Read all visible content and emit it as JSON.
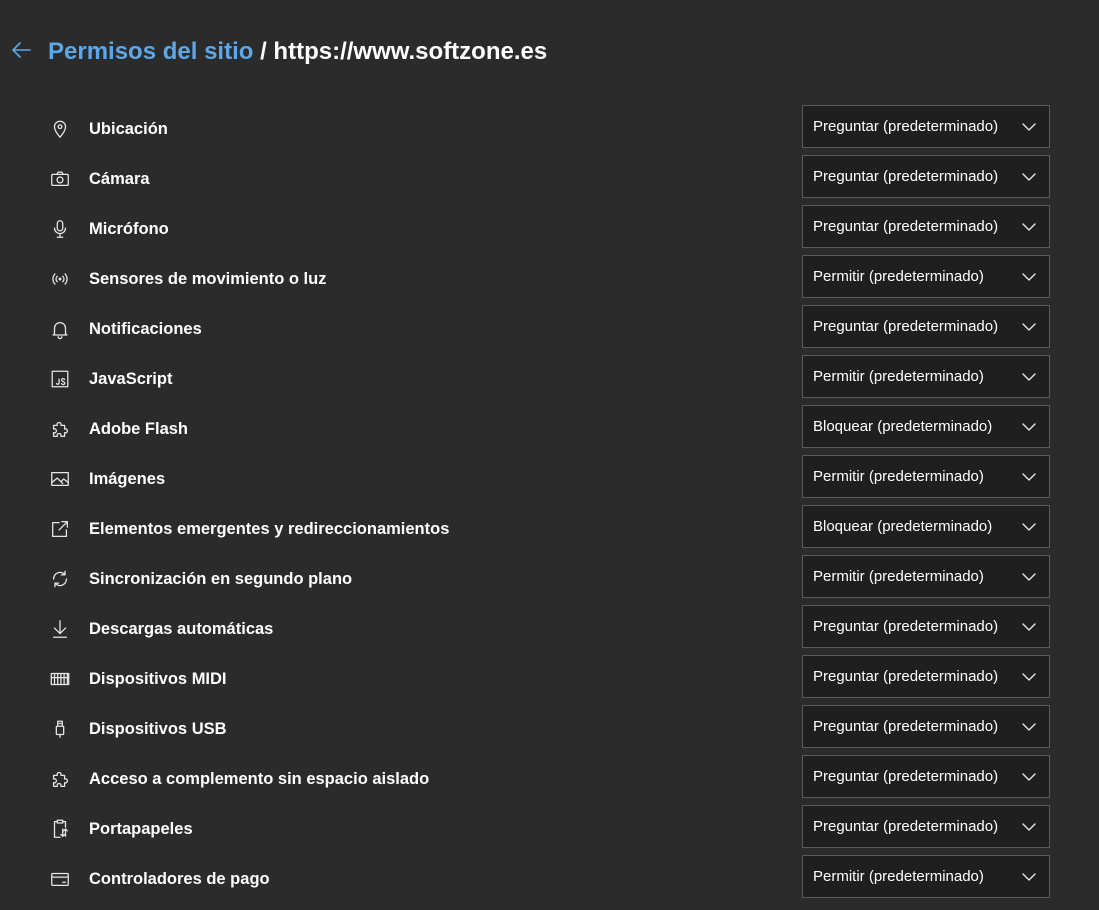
{
  "header": {
    "back_icon": "arrow-left-icon",
    "title_link": "Permisos del sitio",
    "title_separator": " / ",
    "site_url": "https://www.softzone.es",
    "accent_color": "#5ea7e6"
  },
  "permissions": [
    {
      "icon": "location-pin-icon",
      "label": "Ubicación",
      "value": "Preguntar (predeterminado)"
    },
    {
      "icon": "camera-icon",
      "label": "Cámara",
      "value": "Preguntar (predeterminado)"
    },
    {
      "icon": "microphone-icon",
      "label": "Micrófono",
      "value": "Preguntar (predeterminado)"
    },
    {
      "icon": "sensors-icon",
      "label": "Sensores de movimiento o luz",
      "value": "Permitir (predeterminado)"
    },
    {
      "icon": "bell-icon",
      "label": "Notificaciones",
      "value": "Preguntar (predeterminado)"
    },
    {
      "icon": "javascript-icon",
      "label": "JavaScript",
      "value": "Permitir (predeterminado)"
    },
    {
      "icon": "puzzle-icon",
      "label": "Adobe Flash",
      "value": "Bloquear (predeterminado)"
    },
    {
      "icon": "image-icon",
      "label": "Imágenes",
      "value": "Permitir (predeterminado)"
    },
    {
      "icon": "external-link-icon",
      "label": "Elementos emergentes y redireccionamientos",
      "value": "Bloquear (predeterminado)"
    },
    {
      "icon": "sync-icon",
      "label": "Sincronización en segundo plano",
      "value": "Permitir (predeterminado)"
    },
    {
      "icon": "download-icon",
      "label": "Descargas automáticas",
      "value": "Preguntar (predeterminado)"
    },
    {
      "icon": "piano-keyboard-icon",
      "label": "Dispositivos MIDI",
      "value": "Preguntar (predeterminado)"
    },
    {
      "icon": "usb-icon",
      "label": "Dispositivos USB",
      "value": "Preguntar (predeterminado)"
    },
    {
      "icon": "puzzle-icon",
      "label": "Acceso a complemento sin espacio aislado",
      "value": "Preguntar (predeterminado)"
    },
    {
      "icon": "clipboard-icon",
      "label": "Portapapeles",
      "value": "Preguntar (predeterminado)"
    },
    {
      "icon": "credit-card-icon",
      "label": "Controladores de pago",
      "value": "Permitir (predeterminado)"
    }
  ]
}
